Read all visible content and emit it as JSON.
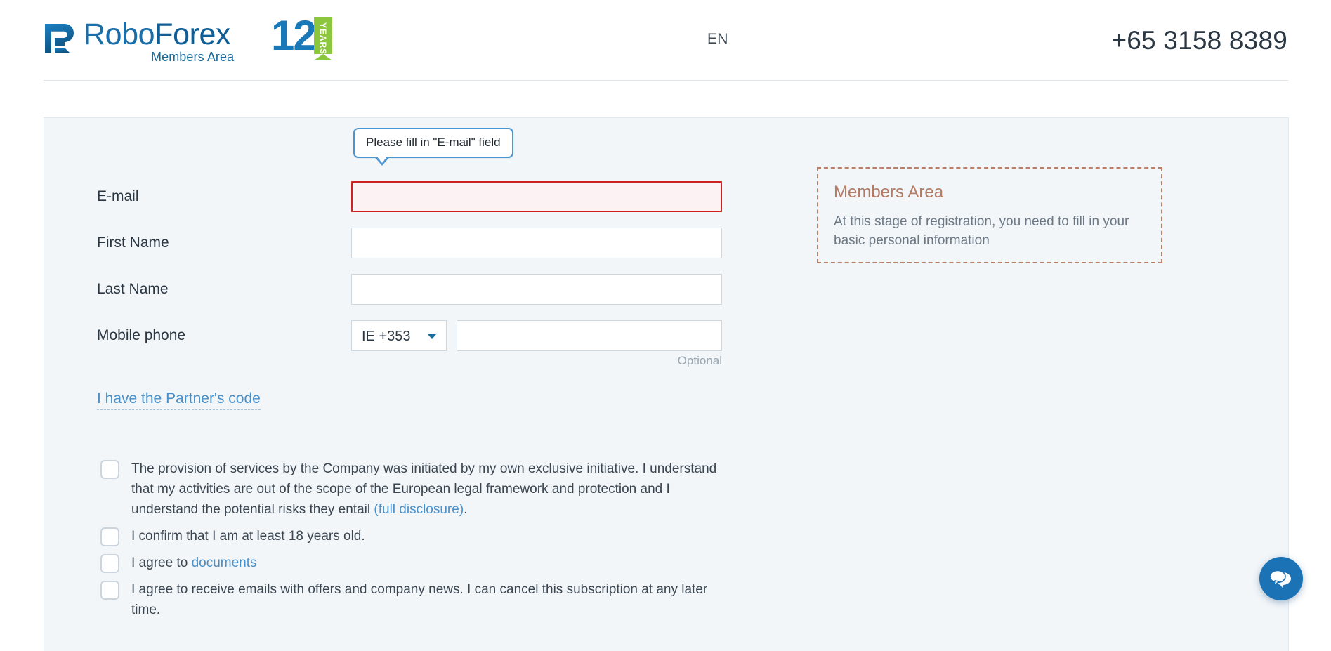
{
  "header": {
    "logo": {
      "mark_icon": "roboforex-r-mark-icon",
      "wordmark_robo": "Robo",
      "wordmark_forex": "Forex",
      "subtitle": "Members Area",
      "anniversary_number": "12",
      "anniversary_ribbon": "YEARS"
    },
    "language": "EN",
    "phone": "+65 3158 8389"
  },
  "form": {
    "tooltip": "Please fill in \"E-mail\" field",
    "fields": [
      {
        "label": "E-mail",
        "value": "",
        "placeholder": "",
        "state": "error"
      },
      {
        "label": "First Name",
        "value": "",
        "placeholder": "",
        "state": "normal"
      },
      {
        "label": "Last Name",
        "value": "",
        "placeholder": "",
        "state": "normal"
      }
    ],
    "phone_row": {
      "label": "Mobile phone",
      "country_code": "IE +353",
      "caret_icon": "chevron-down-icon",
      "value": "",
      "placeholder": "",
      "hint": "Optional"
    },
    "partner_link": "I have the Partner's code"
  },
  "info_box": {
    "title": "Members Area",
    "text": "At this stage of registration, you need to fill in your basic personal information"
  },
  "agreements": [
    {
      "text_before": "The provision of services by the Company was initiated by my own exclusive initiative. I understand that my activities are out of the scope of the European legal framework and protection and I understand the potential risks they entail ",
      "link": "(full disclosure)",
      "text_after": ".",
      "checked": false
    },
    {
      "text_before": "I confirm that I am at least 18 years old.",
      "link": "",
      "text_after": "",
      "checked": false
    },
    {
      "text_before": "I agree to ",
      "link": "documents",
      "text_after": "",
      "checked": false
    },
    {
      "text_before": "I agree to receive emails with offers and company news. I can cancel this subscription at any later time.",
      "link": "",
      "text_after": "",
      "checked": false
    }
  ],
  "chat": {
    "icon": "chat-bubbles-icon",
    "color": "#1b72b5"
  },
  "colors": {
    "brand_blue": "#1878b8",
    "panel_bg": "#f2f6f9",
    "error_border": "#cc2222",
    "error_bg": "#fdf2f3",
    "link": "#4a8fc7",
    "info_border": "#bb7f68",
    "ribbon_green": "#8cc63f"
  }
}
